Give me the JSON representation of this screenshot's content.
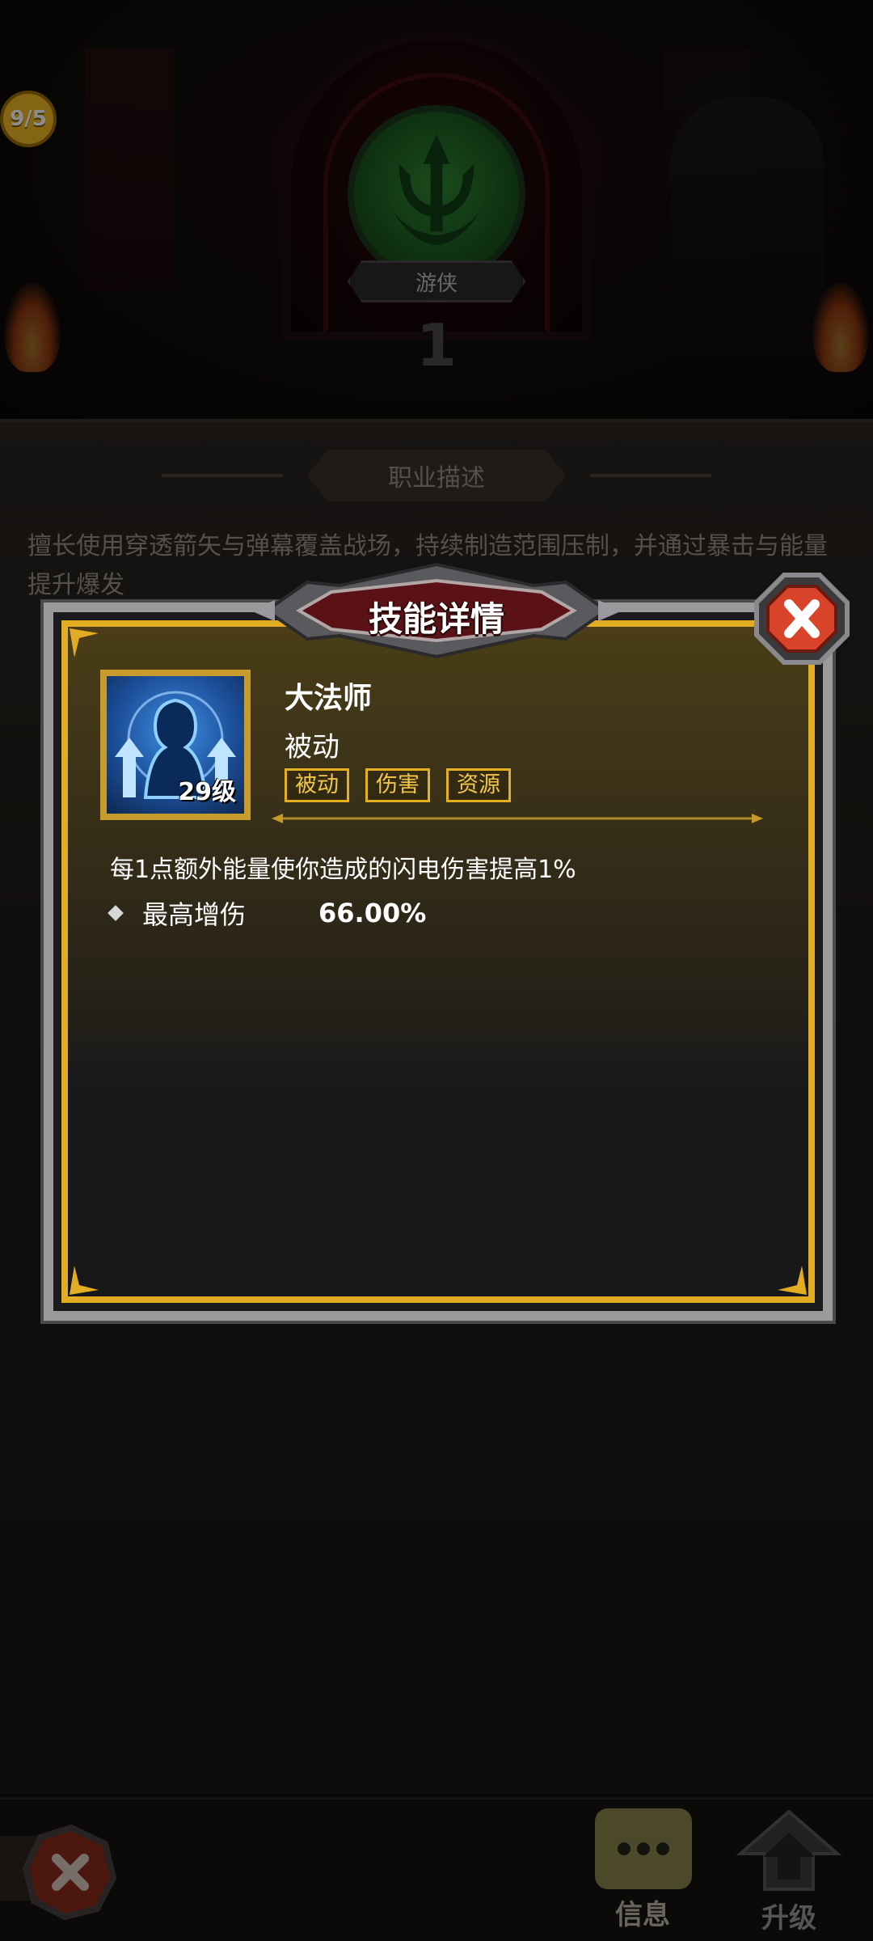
{
  "header": {
    "progress_badge": "9/5",
    "class_name": "游侠",
    "class_level": "1"
  },
  "class_panel": {
    "section_title": "职业描述",
    "description": "擅长使用穿透箭矢与弹幕覆盖战场，持续制造范围压制，并通过暴击与能量提升爆发"
  },
  "dialog": {
    "title": "技能详情",
    "skill": {
      "name": "大法师",
      "type": "被动",
      "level": "29级",
      "tags": [
        "被动",
        "伤害",
        "资源"
      ],
      "effect": "每1点额外能量使你造成的闪电伤害提高1%",
      "stat_label": "最高增伤",
      "stat_value": "66.00%"
    }
  },
  "bottom_nav": {
    "info_label": "信息",
    "upgrade_label": "升级"
  },
  "colors": {
    "gold": "#e2ad22",
    "close_red": "#d8432a",
    "class_green": "#2f8a32",
    "badge_yellow": "#f1b824"
  }
}
